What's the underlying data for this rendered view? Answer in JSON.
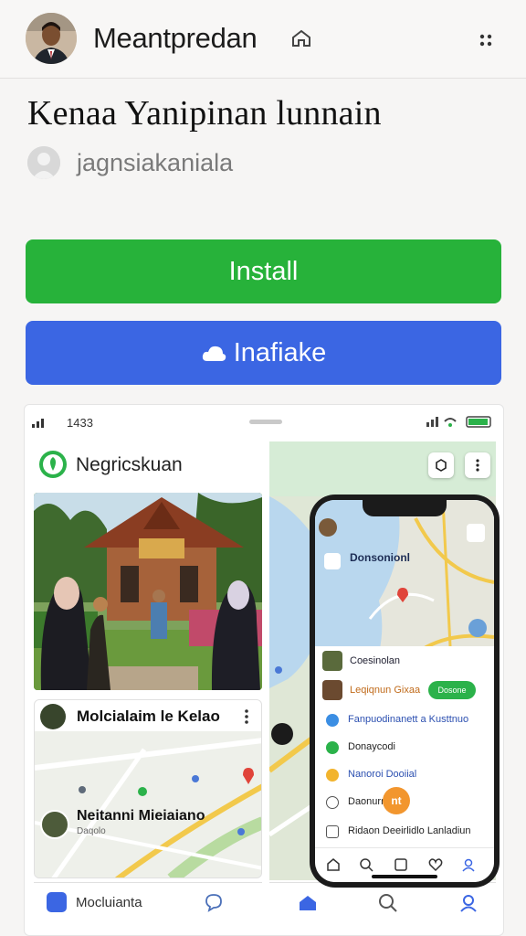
{
  "header": {
    "app_name": "Meantpredan",
    "home_icon": "home-icon",
    "more_icon": "more-dots-icon"
  },
  "listing": {
    "title": "Kenaa Yanipinan lunnain",
    "developer": "jagnsiakaniala"
  },
  "buttons": {
    "install": "Install",
    "secondary": "Inafiake",
    "install_color": "#27b23a",
    "secondary_color": "#3b66e3"
  },
  "screenshot": {
    "status_time": "1433",
    "left": {
      "app_name": "Negricskuan",
      "card_title": "Molcialaim le Kelao",
      "person_name": "Neitanni Mieiaiano",
      "person_sub": "Daqolo",
      "nav_label": "Mocluianta"
    },
    "phone": {
      "map_label": "Donsonionl",
      "row_title": "Coesinolan",
      "row_sub": "Leqiqnun Gixaa",
      "pill": "Dosone",
      "items": [
        "Fanpuodinanett a Kusttnuo",
        "Donaycodi",
        "Nanoroi Dooiial",
        "Daonurn",
        "Ridaon Deeirlidlo Lanladiun"
      ],
      "badge": "nt"
    }
  }
}
